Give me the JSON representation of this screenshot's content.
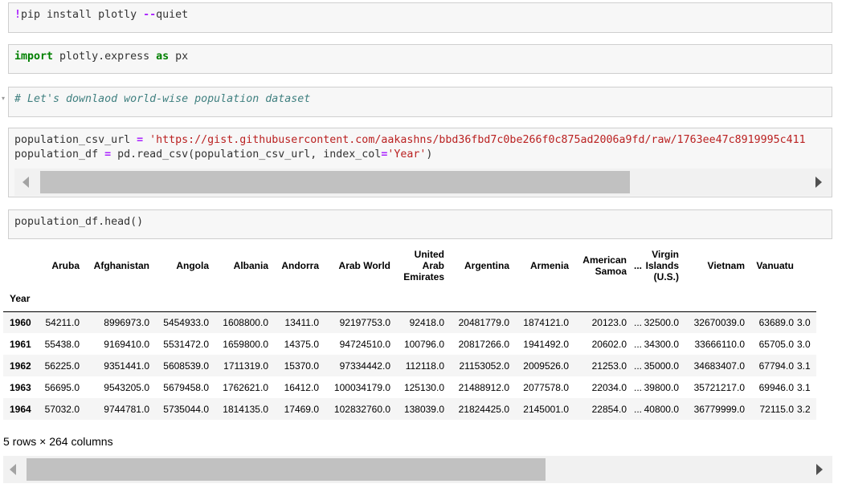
{
  "cells": {
    "pip": {
      "bang": "!",
      "cmd": "pip install plotly ",
      "flag": "--",
      "rest": "quiet"
    },
    "import": {
      "kw1": "import",
      "module": " plotly.express ",
      "kw2": "as",
      "alias": " px"
    },
    "comment": {
      "toggle": "▾",
      "text": "# Let's downlaod world-wise population dataset"
    },
    "read": {
      "line1_var": "population_csv_url ",
      "line1_eq": "=",
      "line1_str": " 'https://gist.githubusercontent.com/aakashns/bbd36fbd7c0be266f0c875ad2006a9fd/raw/1763ee47c8919995c411",
      "line2_a": "population_df ",
      "line2_eq": "=",
      "line2_b": " pd.read_csv(population_csv_url, index_col",
      "line2_eq2": "=",
      "line2_str": "'Year'",
      "line2_end": ")"
    },
    "head": {
      "code": "population_df.head()"
    }
  },
  "table": {
    "columns": [
      "Aruba",
      "Afghanistan",
      "Angola",
      "Albania",
      "Andorra",
      "Arab World",
      "United Arab Emirates",
      "Argentina",
      "Armenia",
      "American Samoa",
      "...",
      "Virgin Islands (U.S.)",
      "Vietnam",
      "Vanuatu",
      ""
    ],
    "index_name": "Year",
    "rows": [
      {
        "year": "1960",
        "values": [
          "54211.0",
          "8996973.0",
          "5454933.0",
          "1608800.0",
          "13411.0",
          "92197753.0",
          "92418.0",
          "20481779.0",
          "1874121.0",
          "20123.0",
          "...",
          "32500.0",
          "32670039.0",
          "63689.0",
          "3.0"
        ]
      },
      {
        "year": "1961",
        "values": [
          "55438.0",
          "9169410.0",
          "5531472.0",
          "1659800.0",
          "14375.0",
          "94724510.0",
          "100796.0",
          "20817266.0",
          "1941492.0",
          "20602.0",
          "...",
          "34300.0",
          "33666110.0",
          "65705.0",
          "3.0"
        ]
      },
      {
        "year": "1962",
        "values": [
          "56225.0",
          "9351441.0",
          "5608539.0",
          "1711319.0",
          "15370.0",
          "97334442.0",
          "112118.0",
          "21153052.0",
          "2009526.0",
          "21253.0",
          "...",
          "35000.0",
          "34683407.0",
          "67794.0",
          "3.1"
        ]
      },
      {
        "year": "1963",
        "values": [
          "56695.0",
          "9543205.0",
          "5679458.0",
          "1762621.0",
          "16412.0",
          "100034179.0",
          "125130.0",
          "21488912.0",
          "2077578.0",
          "22034.0",
          "...",
          "39800.0",
          "35721217.0",
          "69946.0",
          "3.1"
        ]
      },
      {
        "year": "1964",
        "values": [
          "57032.0",
          "9744781.0",
          "5735044.0",
          "1814135.0",
          "17469.0",
          "102832760.0",
          "138039.0",
          "21824425.0",
          "2145001.0",
          "22854.0",
          "...",
          "40800.0",
          "36779999.0",
          "72115.0",
          "3.2"
        ]
      }
    ]
  },
  "summary": "5 rows × 264 columns",
  "icons": {
    "scroll_left": "triangle-left-icon",
    "scroll_right": "triangle-right-icon",
    "collapse": "collapse-caret-icon"
  }
}
